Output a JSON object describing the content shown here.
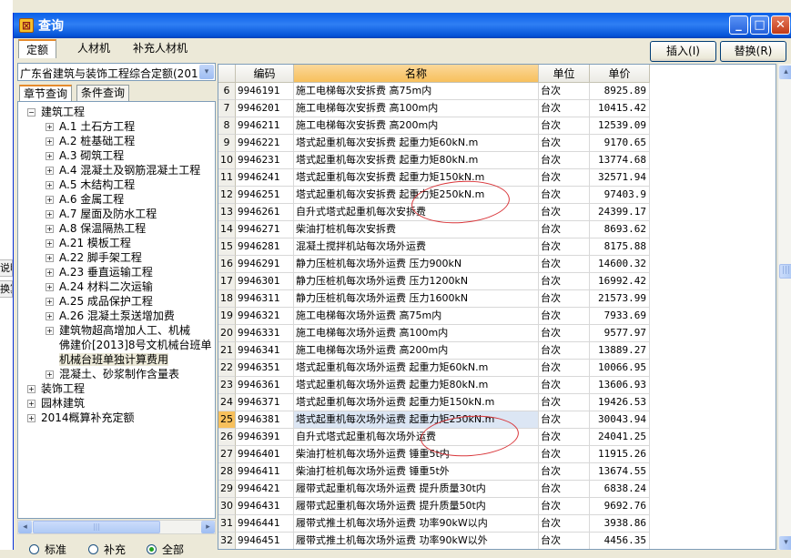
{
  "app": {
    "title": "查询",
    "app_icon": "app-icon"
  },
  "window_buttons": {
    "min": "_",
    "max": "□",
    "close": "✕"
  },
  "background_fragments": [
    "说明",
    "换算"
  ],
  "top_tabs": [
    "定额",
    "人材机",
    "补充人材机"
  ],
  "actions": {
    "insert": "插入(I)",
    "replace": "替换(R)"
  },
  "quota_library": {
    "selected": "广东省建筑与装饰工程综合定额(201",
    "arrow": "▾"
  },
  "sub_tabs": [
    "章节查询",
    "条件查询"
  ],
  "tree": [
    {
      "label": "建筑工程",
      "expander": "−"
    },
    {
      "label": "A.1 土石方工程",
      "expander": "+"
    },
    {
      "label": "A.2 桩基础工程",
      "expander": "+"
    },
    {
      "label": "A.3 砌筑工程",
      "expander": "+"
    },
    {
      "label": "A.4 混凝土及钢筋混凝土工程",
      "expander": "+"
    },
    {
      "label": "A.5 木结构工程",
      "expander": "+"
    },
    {
      "label": "A.6 金属工程",
      "expander": "+"
    },
    {
      "label": "A.7 屋面及防水工程",
      "expander": "+"
    },
    {
      "label": "A.8 保温隔热工程",
      "expander": "+"
    },
    {
      "label": "A.21 模板工程",
      "expander": "+"
    },
    {
      "label": "A.22 脚手架工程",
      "expander": "+"
    },
    {
      "label": "A.23 垂直运输工程",
      "expander": "+"
    },
    {
      "label": "A.24 材料二次运输",
      "expander": "+"
    },
    {
      "label": "A.25 成品保护工程",
      "expander": "+"
    },
    {
      "label": "A.26 混凝土泵送增加费",
      "expander": "+"
    },
    {
      "label": "建筑物超高增加人工、机械",
      "expander": "+"
    },
    {
      "label": "佛建价[2013]8号文机械台班单",
      "expander": ""
    },
    {
      "label": "机械台班单独计算费用",
      "expander": ""
    },
    {
      "label": "混凝土、砂浆制作含量表",
      "expander": "+"
    },
    {
      "label": "装饰工程",
      "expander": "+"
    },
    {
      "label": "园林建筑",
      "expander": "+"
    },
    {
      "label": "2014概算补充定额",
      "expander": "+"
    }
  ],
  "radios": {
    "standard": "标准",
    "supplement": "补充",
    "all": "全部",
    "selected": "all"
  },
  "scroll_arrows": {
    "left": "◂",
    "right": "▸",
    "up": "▴",
    "down": "▾",
    "grip": "|||"
  },
  "grid": {
    "columns": [
      "",
      "编码",
      "名称",
      "单位",
      "单价"
    ],
    "current_row": "25",
    "rows": [
      {
        "rn": "6",
        "code": "9946191",
        "name": "施工电梯每次安拆费 高75m内",
        "unit": "台次",
        "price": "8925.89"
      },
      {
        "rn": "7",
        "code": "9946201",
        "name": "施工电梯每次安拆费 高100m内",
        "unit": "台次",
        "price": "10415.42"
      },
      {
        "rn": "8",
        "code": "9946211",
        "name": "施工电梯每次安拆费 高200m内",
        "unit": "台次",
        "price": "12539.09"
      },
      {
        "rn": "9",
        "code": "9946221",
        "name": "塔式起重机每次安拆费 起重力矩60kN.m",
        "unit": "台次",
        "price": "9170.65"
      },
      {
        "rn": "10",
        "code": "9946231",
        "name": "塔式起重机每次安拆费 起重力矩80kN.m",
        "unit": "台次",
        "price": "13774.68"
      },
      {
        "rn": "11",
        "code": "9946241",
        "name": "塔式起重机每次安拆费 起重力矩150kN.m",
        "unit": "台次",
        "price": "32571.94"
      },
      {
        "rn": "12",
        "code": "9946251",
        "name": "塔式起重机每次安拆费 起重力矩250kN.m",
        "unit": "台次",
        "price": "97403.9"
      },
      {
        "rn": "13",
        "code": "9946261",
        "name": "自升式塔式起重机每次安拆费",
        "unit": "台次",
        "price": "24399.17"
      },
      {
        "rn": "14",
        "code": "9946271",
        "name": "柴油打桩机每次安拆费",
        "unit": "台次",
        "price": "8693.62"
      },
      {
        "rn": "15",
        "code": "9946281",
        "name": "混凝土搅拌机站每次场外运费",
        "unit": "台次",
        "price": "8175.88"
      },
      {
        "rn": "16",
        "code": "9946291",
        "name": "静力压桩机每次场外运费 压力900kN",
        "unit": "台次",
        "price": "14600.32"
      },
      {
        "rn": "17",
        "code": "9946301",
        "name": "静力压桩机每次场外运费 压力1200kN",
        "unit": "台次",
        "price": "16992.42"
      },
      {
        "rn": "18",
        "code": "9946311",
        "name": "静力压桩机每次场外运费 压力1600kN",
        "unit": "台次",
        "price": "21573.99"
      },
      {
        "rn": "19",
        "code": "9946321",
        "name": "施工电梯每次场外运费 高75m内",
        "unit": "台次",
        "price": "7933.69"
      },
      {
        "rn": "20",
        "code": "9946331",
        "name": "施工电梯每次场外运费 高100m内",
        "unit": "台次",
        "price": "9577.97"
      },
      {
        "rn": "21",
        "code": "9946341",
        "name": "施工电梯每次场外运费 高200m内",
        "unit": "台次",
        "price": "13889.27"
      },
      {
        "rn": "22",
        "code": "9946351",
        "name": "塔式起重机每次场外运费 起重力矩60kN.m",
        "unit": "台次",
        "price": "10066.95"
      },
      {
        "rn": "23",
        "code": "9946361",
        "name": "塔式起重机每次场外运费 起重力矩80kN.m",
        "unit": "台次",
        "price": "13606.93"
      },
      {
        "rn": "24",
        "code": "9946371",
        "name": "塔式起重机每次场外运费 起重力矩150kN.m",
        "unit": "台次",
        "price": "19426.53"
      },
      {
        "rn": "25",
        "code": "9946381",
        "name": "塔式起重机每次场外运费 起重力矩250kN.m",
        "unit": "台次",
        "price": "30043.94"
      },
      {
        "rn": "26",
        "code": "9946391",
        "name": "自升式塔式起重机每次场外运费",
        "unit": "台次",
        "price": "24041.25"
      },
      {
        "rn": "27",
        "code": "9946401",
        "name": "柴油打桩机每次场外运费 锤重5t内",
        "unit": "台次",
        "price": "11915.26"
      },
      {
        "rn": "28",
        "code": "9946411",
        "name": "柴油打桩机每次场外运费 锤重5t外",
        "unit": "台次",
        "price": "13674.55"
      },
      {
        "rn": "29",
        "code": "9946421",
        "name": "履带式起重机每次场外运费 提升质量30t内",
        "unit": "台次",
        "price": "6838.24"
      },
      {
        "rn": "30",
        "code": "9946431",
        "name": "履带式起重机每次场外运费 提升质量50t内",
        "unit": "台次",
        "price": "9692.76"
      },
      {
        "rn": "31",
        "code": "9946441",
        "name": "履带式推土机每次场外运费 功率90kW以内",
        "unit": "台次",
        "price": "3938.86"
      },
      {
        "rn": "32",
        "code": "9946451",
        "name": "履带式推土机每次场外运费 功率90kW以外",
        "unit": "台次",
        "price": "4456.35"
      }
    ]
  },
  "colors": {
    "titlebar": "#0a5fe8",
    "header_active": "#f7c05c",
    "annotation": "#d9363a"
  }
}
